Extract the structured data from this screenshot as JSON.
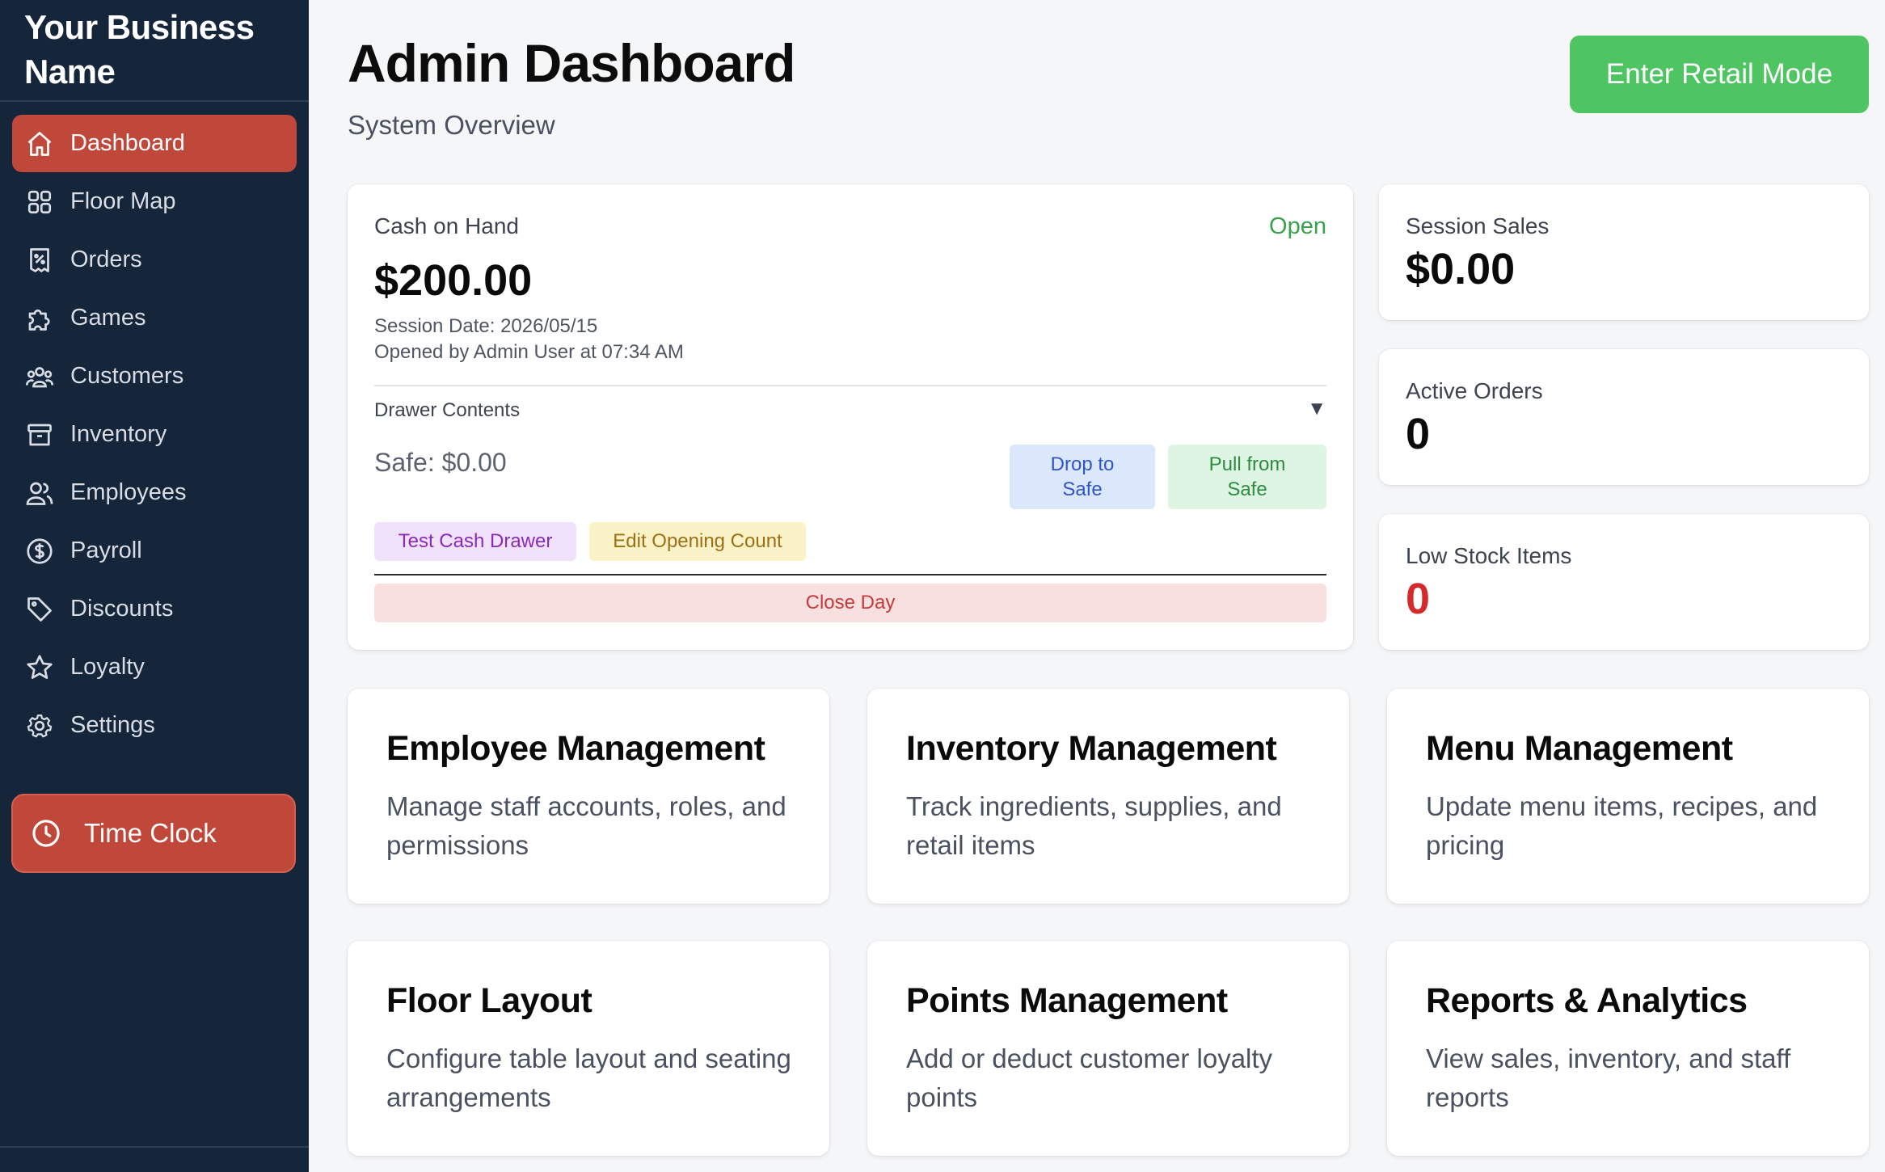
{
  "sidebar": {
    "brand": "Your Business Name",
    "items": [
      {
        "label": "Dashboard",
        "icon": "home-icon",
        "active": true
      },
      {
        "label": "Floor Map",
        "icon": "grid-icon",
        "active": false
      },
      {
        "label": "Orders",
        "icon": "receipt-icon",
        "active": false
      },
      {
        "label": "Games",
        "icon": "puzzle-icon",
        "active": false
      },
      {
        "label": "Customers",
        "icon": "users-icon",
        "active": false
      },
      {
        "label": "Inventory",
        "icon": "archive-icon",
        "active": false
      },
      {
        "label": "Employees",
        "icon": "user-group-icon",
        "active": false
      },
      {
        "label": "Payroll",
        "icon": "dollar-circle-icon",
        "active": false
      },
      {
        "label": "Discounts",
        "icon": "tag-icon",
        "active": false
      },
      {
        "label": "Loyalty",
        "icon": "star-icon",
        "active": false
      },
      {
        "label": "Settings",
        "icon": "gear-icon",
        "active": false
      }
    ],
    "time_clock": "Time Clock"
  },
  "header": {
    "title": "Admin Dashboard",
    "subtitle": "System Overview",
    "retail_button": "Enter Retail Mode"
  },
  "cash": {
    "label": "Cash on Hand",
    "status": "Open",
    "amount": "$200.00",
    "session_date": "Session Date: 2026/05/15",
    "opened_by": "Opened by Admin User at 07:34 AM",
    "drawer_label": "Drawer Contents",
    "drawer_toggle": "▼",
    "safe": "Safe: $0.00",
    "drop_line1": "Drop to",
    "drop_line2": "Safe",
    "pull_line1": "Pull from",
    "pull_line2": "Safe",
    "test_button": "Test Cash Drawer",
    "edit_button": "Edit Opening Count",
    "close_button": "Close Day"
  },
  "stats": [
    {
      "label": "Session Sales",
      "value": "$0.00"
    },
    {
      "label": "Active Orders",
      "value": "0"
    },
    {
      "label": "Low Stock Items",
      "value": "0"
    }
  ],
  "management": [
    {
      "title": "Employee Management",
      "desc": "Manage staff accounts, roles, and permissions"
    },
    {
      "title": "Inventory Management",
      "desc": "Track ingredients, supplies, and retail items"
    },
    {
      "title": "Menu Management",
      "desc": "Update menu items, recipes, and pricing"
    },
    {
      "title": "Floor Layout",
      "desc": "Configure table layout and seating arrangements"
    },
    {
      "title": "Points Management",
      "desc": "Add or deduct customer loyalty points"
    },
    {
      "title": "Reports & Analytics",
      "desc": "View sales, inventory, and staff reports"
    }
  ],
  "colors": {
    "sidebar_bg": "#15253a",
    "active_accent": "#c0483a",
    "retail_green": "#4fc462",
    "open_green": "#3aa14b",
    "low_stock_red": "#d42a2a"
  }
}
